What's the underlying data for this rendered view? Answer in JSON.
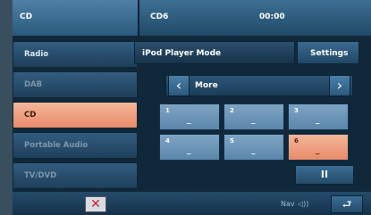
{
  "header": {
    "source": "CD",
    "track": "CD6",
    "time": "00:00"
  },
  "sidebar": {
    "items": [
      {
        "label": "Radio"
      },
      {
        "label": "DAB"
      },
      {
        "label": "CD"
      },
      {
        "label": "Portable Audio"
      },
      {
        "label": "TV/DVD"
      }
    ]
  },
  "mode": {
    "title": "iPod Player Mode",
    "settings_label": "Settings"
  },
  "browser": {
    "label": "More",
    "prev_icon": "chevron-left-icon",
    "next_icon": "chevron-right-icon"
  },
  "presets": [
    {
      "num": "1",
      "value": "_"
    },
    {
      "num": "2",
      "value": "_"
    },
    {
      "num": "3",
      "value": "_"
    },
    {
      "num": "4",
      "value": "_"
    },
    {
      "num": "5",
      "value": "_"
    },
    {
      "num": "6",
      "value": "_"
    }
  ],
  "controls": {
    "pause_symbol": "II"
  },
  "bottom": {
    "close_symbol": "✕",
    "nav_label": "Nav",
    "volume_symbol": "◁))",
    "back_symbol": "⮐"
  },
  "colors": {
    "active_accent": "#e98b6a",
    "panel": "#214a68"
  }
}
